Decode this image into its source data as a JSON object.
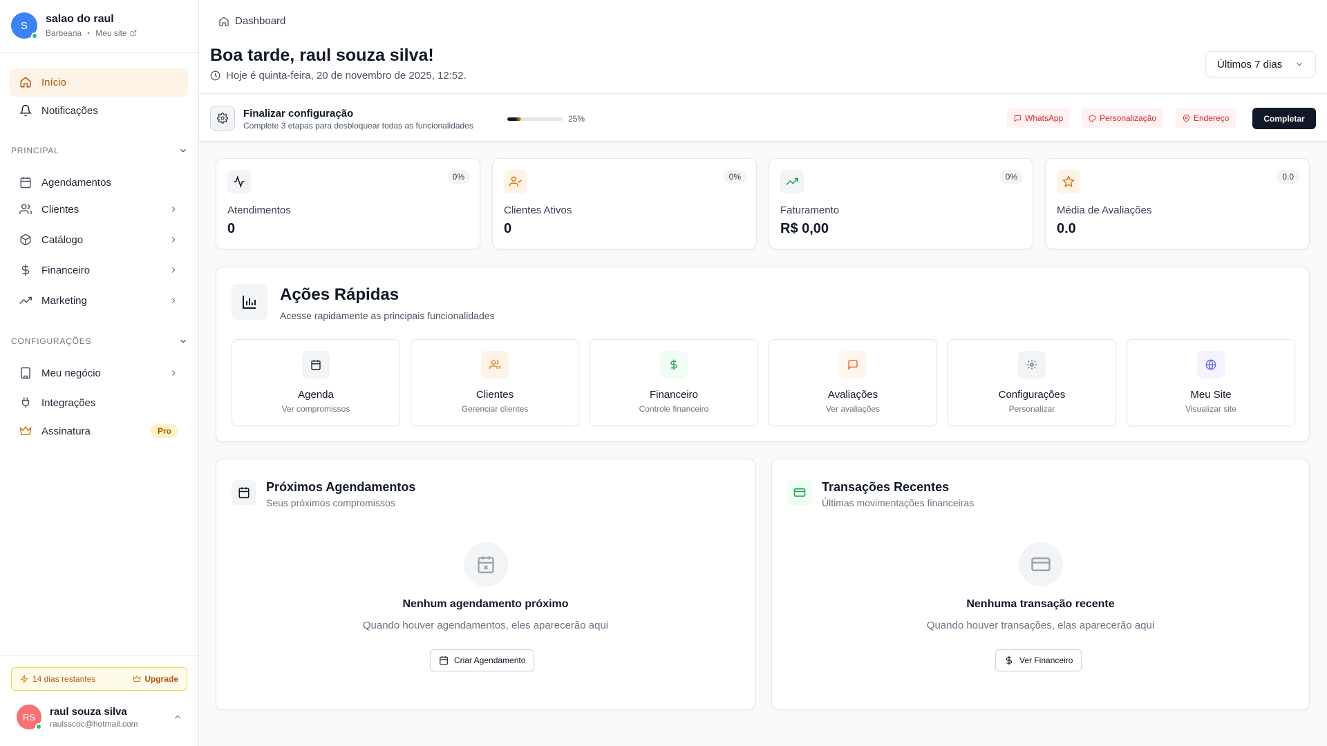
{
  "sidebar": {
    "brand": {
      "initial": "S",
      "name": "salao do raul",
      "category": "Barbearia",
      "separator": "•",
      "site_link": "Meu site"
    },
    "nav_top": [
      {
        "label": "Início",
        "icon": "home-icon",
        "active": true
      },
      {
        "label": "Notificações",
        "icon": "bell-icon"
      }
    ],
    "section_principal": "PRINCIPAL",
    "principal_items": [
      {
        "label": "Agendamentos",
        "icon": "calendar-icon"
      },
      {
        "label": "Clientes",
        "icon": "users-icon"
      },
      {
        "label": "Catálogo",
        "icon": "package-icon"
      },
      {
        "label": "Financeiro",
        "icon": "dollar-icon"
      },
      {
        "label": "Marketing",
        "icon": "trending-up-icon"
      }
    ],
    "section_config": "CONFIGURAÇÕES",
    "config_items": [
      {
        "label": "Meu negócio",
        "icon": "building-icon"
      },
      {
        "label": "Integrações",
        "icon": "plug-icon"
      },
      {
        "label": "Assinatura",
        "icon": "crown-icon",
        "badge": "Pro"
      }
    ],
    "trial": {
      "days": "14 dias restantes",
      "upgrade": "Upgrade"
    },
    "user": {
      "initials": "RS",
      "name": "raul souza silva",
      "email": "raulsscoc@hotmail.com"
    }
  },
  "header": {
    "breadcrumb": "Dashboard",
    "greeting": "Boa tarde, raul souza silva!",
    "date": "Hoje é quinta-feira, 20 de novembro de 2025, 12:52.",
    "period": "Últimos 7 dias"
  },
  "setup": {
    "title": "Finalizar configuração",
    "subtitle": "Complete 3 etapas para desbloquear todas as funcionalidades",
    "progress": 0.25,
    "progress_label": "25%",
    "chips": [
      "WhatsApp",
      "Personalização",
      "Endereço"
    ],
    "complete_label": "Completar"
  },
  "stats": [
    {
      "label": "Atendimentos",
      "value": "0",
      "badge": "0%",
      "icon": "activity-icon"
    },
    {
      "label": "Clientes Ativos",
      "value": "0",
      "badge": "0%",
      "icon": "user-check-icon"
    },
    {
      "label": "Faturamento",
      "value": "R$ 0,00",
      "badge": "0%",
      "icon": "trending-up-icon"
    },
    {
      "label": "Média de Avaliações",
      "value": "0.0",
      "badge": "0.0",
      "icon": "star-icon"
    }
  ],
  "quick_actions": {
    "title": "Ações Rápidas",
    "subtitle": "Acesse rapidamente as principais funcionalidades",
    "items": [
      {
        "title": "Agenda",
        "subtitle": "Ver compromissos",
        "icon": "calendar-icon"
      },
      {
        "title": "Clientes",
        "subtitle": "Gerenciar clientes",
        "icon": "users-icon"
      },
      {
        "title": "Financeiro",
        "subtitle": "Controle financeiro",
        "icon": "dollar-icon"
      },
      {
        "title": "Avaliações",
        "subtitle": "Ver avaliações",
        "icon": "message-icon"
      },
      {
        "title": "Configurações",
        "subtitle": "Personalizar",
        "icon": "gear-icon"
      },
      {
        "title": "Meu Site",
        "subtitle": "Visualizar site",
        "icon": "globe-icon"
      }
    ]
  },
  "appointments": {
    "title": "Próximos Agendamentos",
    "subtitle": "Seus próximos compromissos",
    "empty_title": "Nenhum agendamento próximo",
    "empty_sub": "Quando houver agendamentos, eles aparecerão aqui",
    "button": "Criar Agendamento"
  },
  "transactions": {
    "title": "Transações Recentes",
    "subtitle": "Últimas movimentações financeiras",
    "empty_title": "Nenhuma transação recente",
    "empty_sub": "Quando houver transações, elas aparecerão aqui",
    "button": "Ver Financeiro"
  },
  "colors": {
    "accent": "#b45309",
    "active_bg": "#fdf4e7",
    "primary_button": "#111827",
    "chip_text": "#dc2626",
    "chip_bg": "#fef2f2"
  }
}
